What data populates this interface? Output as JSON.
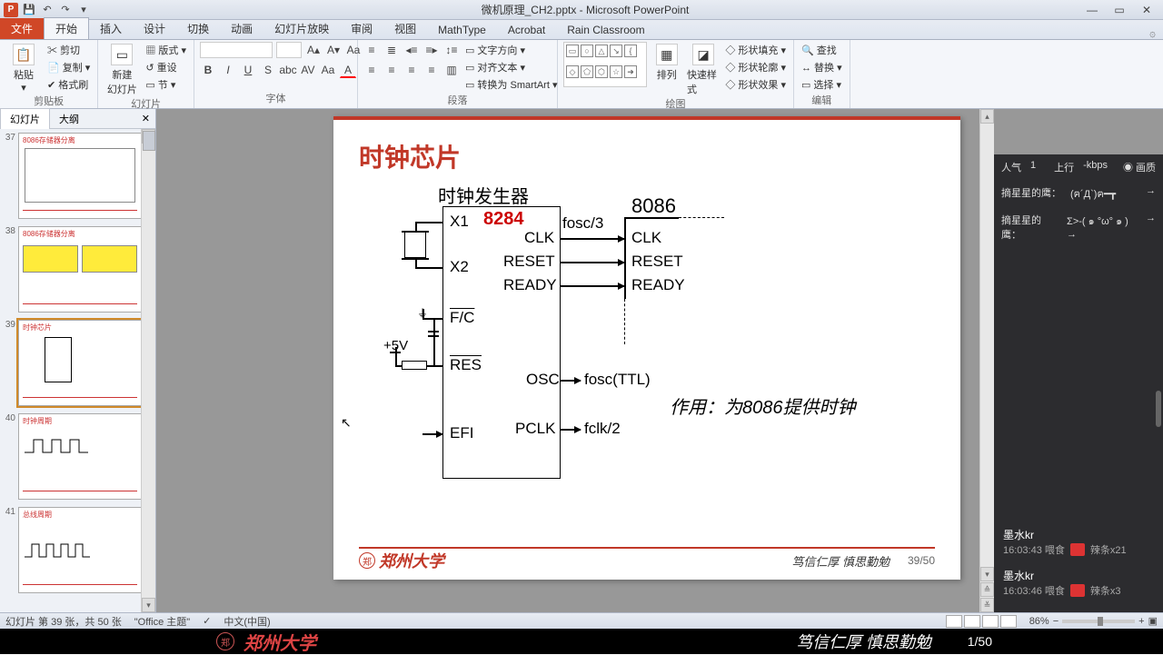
{
  "app": {
    "title": "微机原理_CH2.pptx - Microsoft PowerPoint"
  },
  "win": {
    "min": "—",
    "max": "▭",
    "close": "✕"
  },
  "qat": {
    "logo": "P",
    "save": "💾",
    "undo": "↶",
    "redo": "↷",
    "down": "▾"
  },
  "tabs": {
    "file": "文件",
    "home": "开始",
    "insert": "插入",
    "design": "设计",
    "trans": "切换",
    "anim": "动画",
    "show": "幻灯片放映",
    "review": "审阅",
    "view": "视图",
    "math": "MathType",
    "acrobat": "Acrobat",
    "rain": "Rain Classroom",
    "help": "۞"
  },
  "ribbon": {
    "clipboard": {
      "label": "剪贴板",
      "paste": "粘贴",
      "cut": "✂ 剪切",
      "copy": "📄 复制 ▾",
      "brush": "✔ 格式刷"
    },
    "slides": {
      "label": "幻灯片",
      "new": "新建\n幻灯片",
      "layout": "▦ 版式 ▾",
      "reset": "↺ 重设",
      "section": "▭ 节 ▾"
    },
    "font": {
      "label": "字体",
      "size_up": "A▴",
      "size_dn": "A▾"
    },
    "para": {
      "label": "段落",
      "dir": "▭ 文字方向 ▾",
      "align": "▭ 对齐文本 ▾",
      "smart": "▭ 转换为 SmartArt ▾"
    },
    "draw": {
      "label": "绘图",
      "arrange": "排列",
      "quick": "快速样式",
      "fill": "◇ 形状填充 ▾",
      "outline": "◇ 形状轮廓 ▾",
      "effect": "◇ 形状效果 ▾"
    },
    "edit": {
      "label": "编辑",
      "find": "🔍 查找",
      "replace": "↔ 替换 ▾",
      "select": "▭ 选择 ▾"
    }
  },
  "thumbpane": {
    "tab1": "幻灯片",
    "tab2": "大纲",
    "close": "✕"
  },
  "thumbs": [
    {
      "n": "37",
      "title": "8086存储器分离"
    },
    {
      "n": "38",
      "title": "8086存储器分离"
    },
    {
      "n": "39",
      "title": "时钟芯片",
      "sel": true
    },
    {
      "n": "40",
      "title": "时钟周期"
    },
    {
      "n": "41",
      "title": "总线周期"
    }
  ],
  "slide": {
    "title": "时钟芯片",
    "generator_label": "时钟发生器",
    "chip_name": "8284",
    "cpu_name": "8086",
    "x1": "X1",
    "x2": "X2",
    "fc": "F/C",
    "res": "RES",
    "efi": "EFI",
    "clk": "CLK",
    "reset": "RESET",
    "ready": "READY",
    "osc": "OSC",
    "pclk": "PCLK",
    "clk2": "CLK",
    "reset2": "RESET",
    "ready2": "READY",
    "fosc3": "fosc/3",
    "foscttl": "fosc(TTL)",
    "fclk2": "fclk/2",
    "v5": "+5V",
    "note": "作用：为8086提供时钟",
    "university": "郑州大学",
    "uni_mark": "郑",
    "motto": "笃信仁厚  慎思勤勉",
    "page": "39/50"
  },
  "overlay": {
    "stat_pop": "人气",
    "stat_pop_v": "1",
    "stat_up": "上行",
    "stat_up_v": "-kbps",
    "stat_rec": "◉ 画质",
    "msg1_u": "摘星星的鹰：",
    "msg1_t": "(ฅ´Д`)ฅ━┳",
    "msg2_u": "摘星星的鹰：",
    "msg2_t": "Σ>-( ๑ °ω° ๑ ) →",
    "chat": [
      {
        "name": "墨水kr",
        "meta": "16:03:43 喂食",
        "gift": "辣条x21"
      },
      {
        "name": "墨水kr",
        "meta": "16:03:46 喂食",
        "gift": "辣条x3"
      }
    ]
  },
  "status": {
    "slide": "幻灯片 第 39 张，共 50 张",
    "theme": "\"Office 主题\"",
    "lang_ic": "✓",
    "lang": "中文(中国)",
    "zoom": "86%",
    "fit": "▣"
  },
  "video": {
    "uni": "郑州大学",
    "uni_mark": "郑",
    "motto": "笃信仁厚  慎思勤勉",
    "page": "1/50"
  }
}
